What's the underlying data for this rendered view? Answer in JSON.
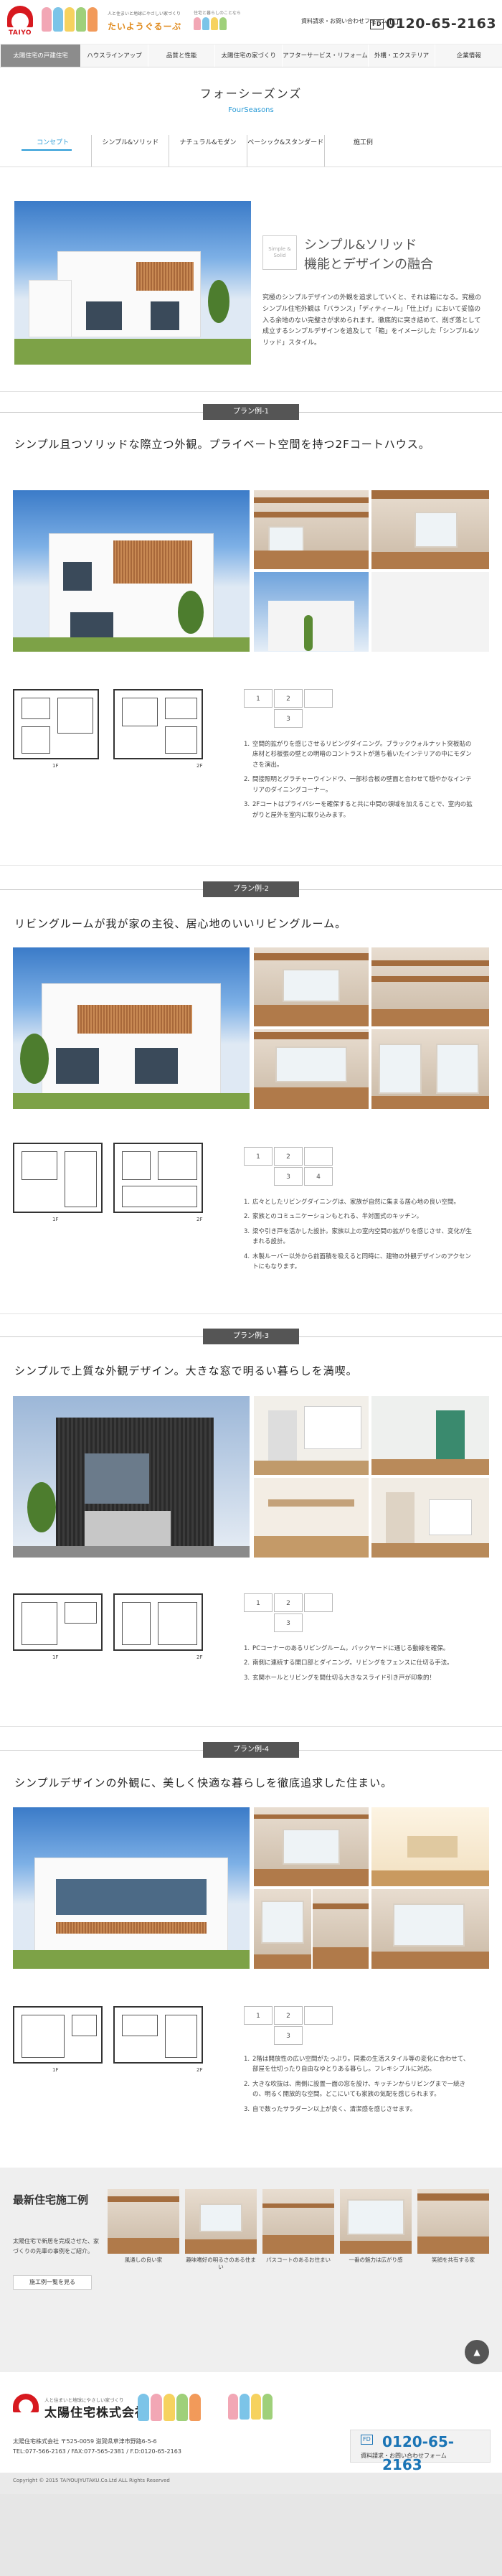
{
  "header": {
    "logo_text": "TAIYO",
    "tagline": "人と住まいと地球にやさしい家づくり",
    "tagline_brand": "たいようぐるーぷ",
    "mid_small": "住宅と暮らしのことなら",
    "contact_label": "資料請求・お問い合わせフォーム",
    "fd_label": "FD",
    "phone": "0120-65-2163"
  },
  "nav": {
    "items": [
      "太陽住宅の戸建住宅",
      "ハウスラインアップ",
      "品質と性能",
      "太陽住宅の家づくり",
      "アフターサービス・リフォーム",
      "外構・エクステリア",
      "企業情報"
    ]
  },
  "title": {
    "main": "フォーシーズンズ",
    "sub": "FourSeasons"
  },
  "tabs": [
    "コンセプト",
    "シンプル&ソリッド",
    "ナチュラル&モダン",
    "ベーシック&スタンダード",
    "施工例"
  ],
  "concept": {
    "badge": "Simple & Solid",
    "heading_line1": "シンプル&ソリッド",
    "heading_line2": "機能とデザインの融合",
    "text": "究極のシンプルデザインの外観を追求していくと、それは箱になる。究極のシンプル住宅外観は「バランス」「ディティール」「仕上げ」において妥協の入る余地のない完璧さが求められます。徹底的に突き詰めて、削ぎ落として成立するシンプルデザインを追及して「箱」をイメージした「シンプル&ソリッド」スタイル。"
  },
  "plans": [
    {
      "label": "プラン例-1",
      "heading": "シンプル且つソリッドな際立つ外観。プライベート空間を持つ2Fコートハウス。",
      "notes": [
        "空間的拡がりを感じさせるリビングダイニング。ブラックウォルナット突板貼の床材と杉板張の壁との明暗のコントラストが落ち着いたインテリアの中にモダンさを演出。",
        "間接照明とグラチャーウインドウ、一部杉合板の壁面と合わせて穏やかなインテリアのダイニングコーナー。",
        "2Fコートはプライバシーを確保すると共に中間の領域を加えることで、室内の拡がりと屋外を室内に取り込みます。"
      ],
      "fp_labels": [
        "1F",
        "2F"
      ]
    },
    {
      "label": "プラン例-2",
      "heading": "リビングルームが我が家の主役、居心地のいいリビングルーム。",
      "notes": [
        "広々としたリビングダイニングは、家族が自然に集まる居心地の良い空間。",
        "家族とのコミュニケーションもとれる、半対面式のキッチン。",
        "梁や引き戸を活かした設計。家族以上の室内空間の拡がりを感じさせ、変化が生まれる設計。",
        "木製ルーバー以外から前面積を吸えると同時に、建物の外観デザインのアクセントにもなります。"
      ],
      "fp_labels": [
        "1F",
        "2F"
      ]
    },
    {
      "label": "プラン例-3",
      "heading": "シンプルで上質な外観デザイン。大きな窓で明るい暮らしを満喫。",
      "notes": [
        "PCコーナーのあるリビングルーム。バックヤードに通じる動線を確保。",
        "南側に連続する開口部とダイニング。リビングをフェンスに仕切る手法。",
        "玄関ホールとリビングを間仕切る大きなスライド引き戸が印象的！"
      ],
      "fp_labels": [
        "1F",
        "2F"
      ]
    },
    {
      "label": "プラン例-4",
      "heading": "シンプルデザインの外観に、美しく快適な暮らしを徹底追求した住まい。",
      "notes": [
        "2階は開放性の広い空間がたっぷり。同素の生活スタイル等の変化に合わせて、部屋を仕切ったり自由なゆとりある暮らし。フレキシブルに対応。",
        "大きな吹抜は、南側に設置一面の窓を設け、キッチンからリビングまで一続きの、明るく開放的な空間。どこにいても家族の気配を感じられます。",
        "自で数ったサラダーン以上が良く、清潔感を感じさせます。"
      ],
      "fp_labels": [
        "1F",
        "2F"
      ]
    }
  ],
  "latest": {
    "title": "最新住宅施工例",
    "desc": "太陽住宅で新居を完成させた、家づくりの先輩の事例をご紹介。",
    "more": "施工例一覧を見る",
    "cards": [
      "風通しの良い家",
      "趣味嗜好の明るさのある住まい",
      "パスコートのあるお住まい",
      "一番の魅力は広がり感",
      "笑顔を共有する家"
    ],
    "pagetop": "▲"
  },
  "footer": {
    "tag": "人と住まいと地球にやさしい家づくり",
    "name": "太陽住宅株式会社",
    "address": "太陽住宅株式会社 〒525-0059 滋賀県草津市野路6-5-6",
    "tel": "TEL:077-566-2163 / FAX:077-565-2381 / F.D:0120-65-2163",
    "phone": "0120-65-2163",
    "fd": "FD",
    "mail": "資料請求・お問い合わせフォーム",
    "copyright": "Copyright © 2015 TAIYOUJYUTAKU.Co.Ltd ALL Rights Reserved"
  },
  "colors": {
    "accent": "#2a9bd6",
    "brand_red": "#d7191f",
    "phone_blue": "#1a74b5"
  }
}
